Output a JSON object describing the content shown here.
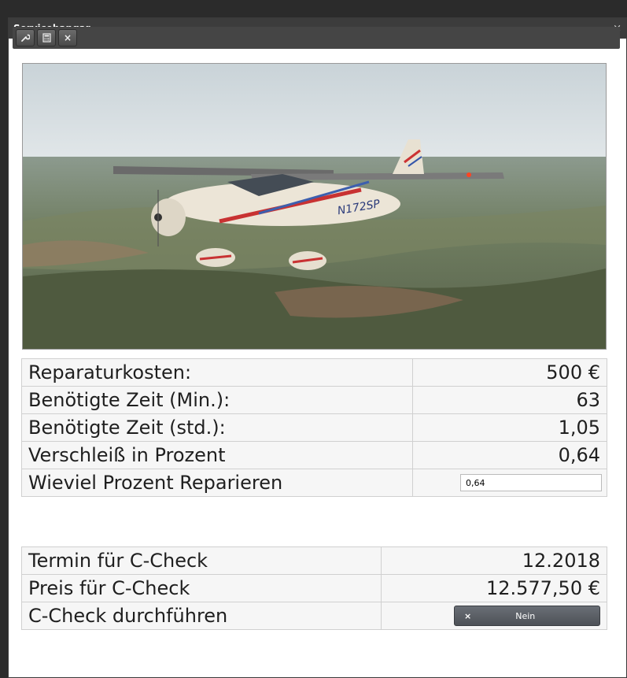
{
  "window": {
    "title": "Servicehangar",
    "close_glyph": "×"
  },
  "toolbar": {
    "buttons": [
      {
        "icon": "wrench-icon",
        "glyph": "🔧"
      },
      {
        "icon": "calculator-icon",
        "glyph": "▦"
      },
      {
        "icon": "close-icon",
        "glyph": "×"
      }
    ]
  },
  "photo": {
    "registration": "N172SP"
  },
  "repair": {
    "rows": [
      {
        "label": "Reparaturkosten:",
        "value": "500 €"
      },
      {
        "label": "Benötigte Zeit (Min.):",
        "value": "63"
      },
      {
        "label": "Benötigte Zeit (std.):",
        "value": "1,05"
      },
      {
        "label": "Verschleiß in Prozent",
        "value": "0,64"
      }
    ],
    "percent_label": "Wieviel Prozent Reparieren",
    "percent_value": "0,64"
  },
  "ccheck": {
    "date_label": "Termin für C-Check",
    "date_value": "12.2018",
    "price_label": "Preis für C-Check",
    "price_value": "12.577,50 €",
    "perform_label": "C-Check durchführen",
    "perform_button": "Nein",
    "perform_button_glyph": "×"
  }
}
